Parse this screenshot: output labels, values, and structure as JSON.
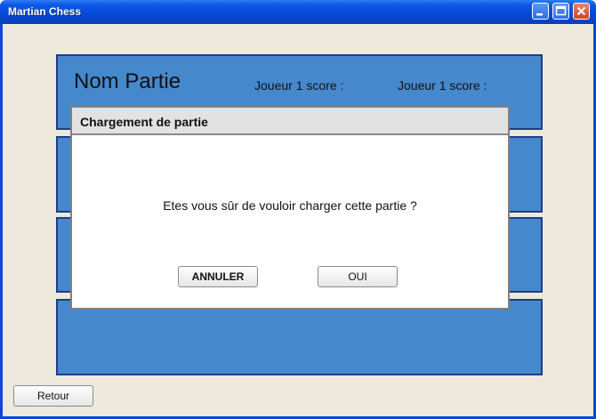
{
  "window": {
    "title": "Martian Chess"
  },
  "game_panel": {
    "name": "Nom Partie",
    "player1_score_label": "Joueur 1 score :",
    "player2_score_label": "Joueur 1 score :"
  },
  "dialog": {
    "title": "Chargement de partie",
    "message": "Etes vous sûr de vouloir charger cette partie ?",
    "cancel_label": "ANNULER",
    "ok_label": "OUI"
  },
  "footer": {
    "back_label": "Retour"
  }
}
